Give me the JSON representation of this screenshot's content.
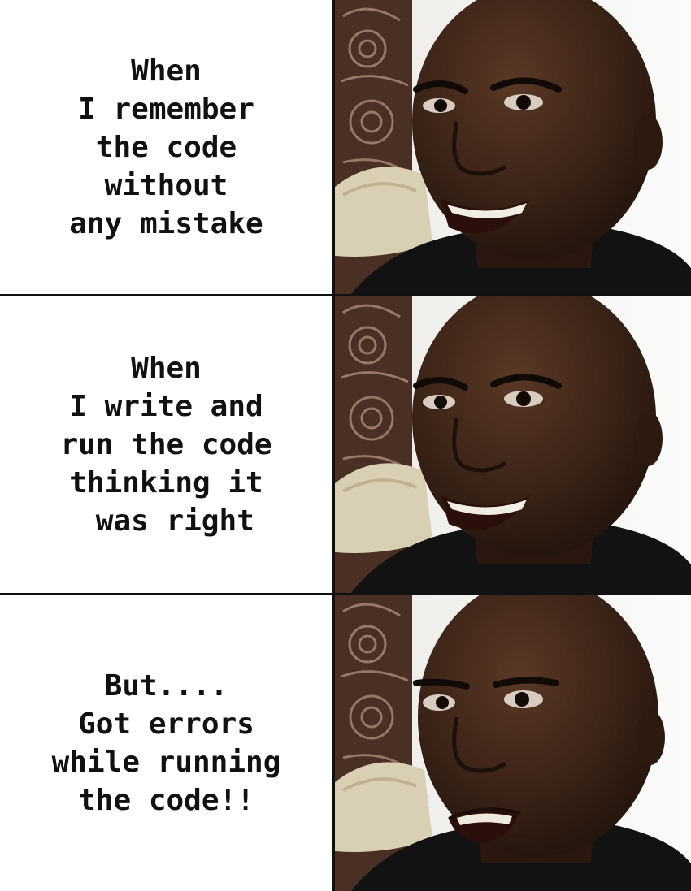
{
  "panels": [
    {
      "caption": "When\nI remember\nthe code\nwithout\nany mistake",
      "reaction": "happy"
    },
    {
      "caption": "When\nI write and\nrun the code\nthinking it\n was right",
      "reaction": "happy"
    },
    {
      "caption": "But....\nGot errors\nwhile running\nthe code!!",
      "reaction": "disappointed"
    }
  ],
  "colors": {
    "background": "#ffffff",
    "text": "#111111",
    "divider": "#111111",
    "skin": "#3b2418",
    "shirt": "#121212",
    "wall": "#f4f4f3",
    "carving": "#5a3a2e",
    "cushion": "#d9cfb4"
  }
}
